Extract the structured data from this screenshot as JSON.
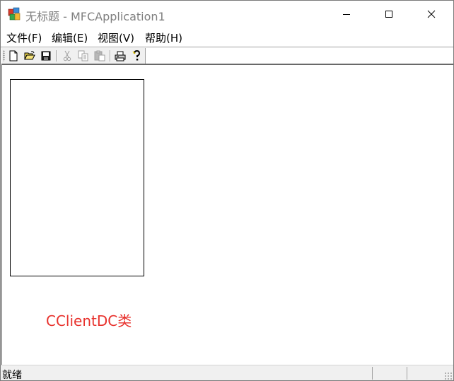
{
  "window": {
    "title": "无标题 - MFCApplication1"
  },
  "menu": {
    "items": [
      {
        "label": "文件(F)"
      },
      {
        "label": "编辑(E)"
      },
      {
        "label": "视图(V)"
      },
      {
        "label": "帮助(H)"
      }
    ]
  },
  "toolbar": {
    "buttons": [
      {
        "icon": "new-file-icon",
        "enabled": true
      },
      {
        "icon": "open-folder-icon",
        "enabled": true
      },
      {
        "icon": "save-icon",
        "enabled": true
      },
      {
        "icon": "cut-icon",
        "enabled": false
      },
      {
        "icon": "copy-icon",
        "enabled": false
      },
      {
        "icon": "paste-icon",
        "enabled": false
      },
      {
        "icon": "print-icon",
        "enabled": true
      },
      {
        "icon": "help-icon",
        "enabled": true
      }
    ]
  },
  "canvas": {
    "label": "CClientDC类",
    "label_color": "#e8322d"
  },
  "status": {
    "text": "就绪"
  },
  "colors": {
    "disabled_icon": "#a0a0a0",
    "title_text": "#808080"
  }
}
